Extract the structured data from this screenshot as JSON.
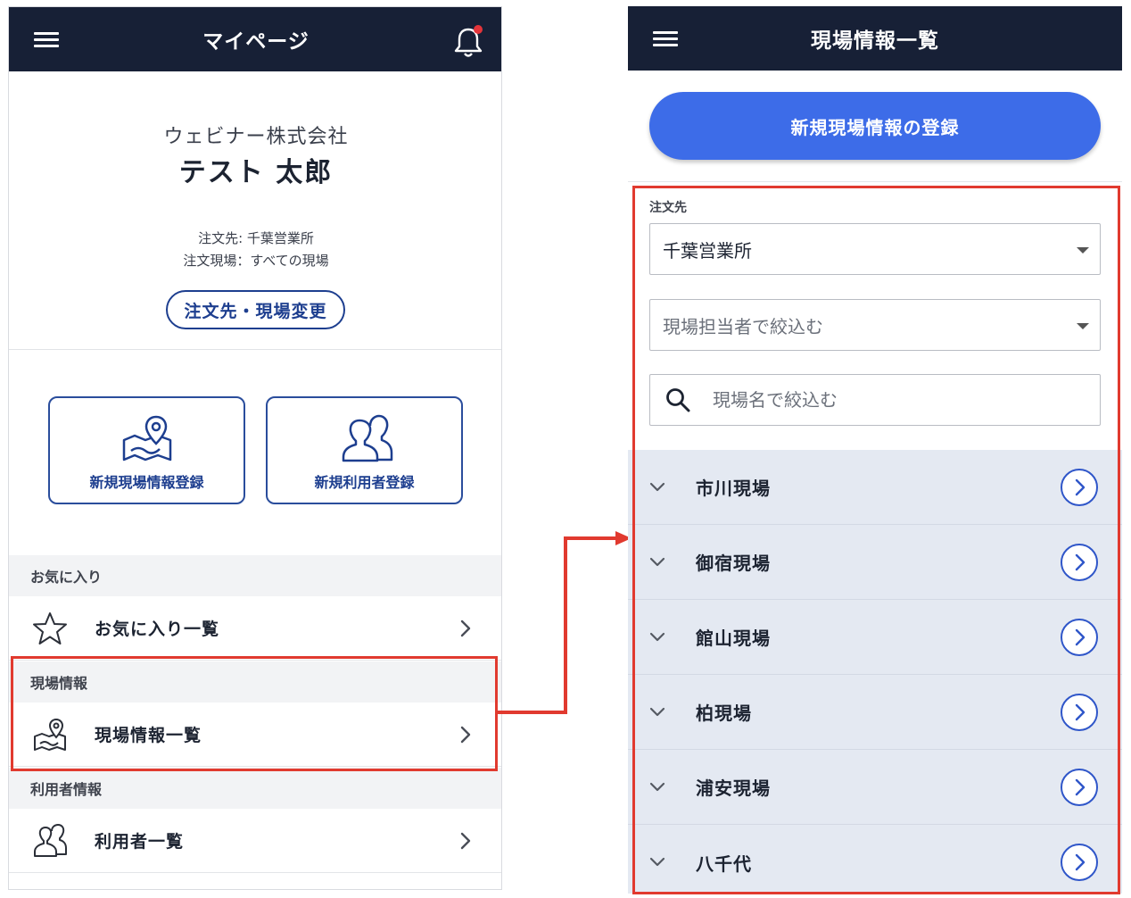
{
  "left": {
    "header_title": "マイページ",
    "company": "ウェビナー株式会社",
    "user_name": "テスト 太郎",
    "order_to": "注文先: 千葉営業所",
    "order_site": "注文現場：すべての現場",
    "change_button": "注文先・現場変更",
    "quick_actions": [
      {
        "label": "新規現場情報登録",
        "icon": "map-pin-icon"
      },
      {
        "label": "新規利用者登録",
        "icon": "users-icon"
      }
    ],
    "sections": [
      {
        "heading": "お気に入り",
        "item": "お気に入り一覧",
        "icon": "star-icon"
      },
      {
        "heading": "現場情報",
        "item": "現場情報一覧",
        "icon": "map-pin-icon"
      },
      {
        "heading": "利用者情報",
        "item": "利用者一覧",
        "icon": "users-icon"
      }
    ]
  },
  "right": {
    "header_title": "現場情報一覧",
    "register_button": "新規現場情報の登録",
    "order_to_label": "注文先",
    "order_to_value": "千葉営業所",
    "manager_placeholder": "現場担当者で絞込む",
    "search_placeholder": "現場名で絞込む",
    "sites": [
      "市川現場",
      "御宿現場",
      "館山現場",
      "柏現場",
      "浦安現場",
      "八千代"
    ]
  },
  "colors": {
    "header_bg": "#172036",
    "accent_blue": "#3d6ce8",
    "highlight_red": "#e13a2f",
    "list_bg": "#e4e9f2"
  }
}
